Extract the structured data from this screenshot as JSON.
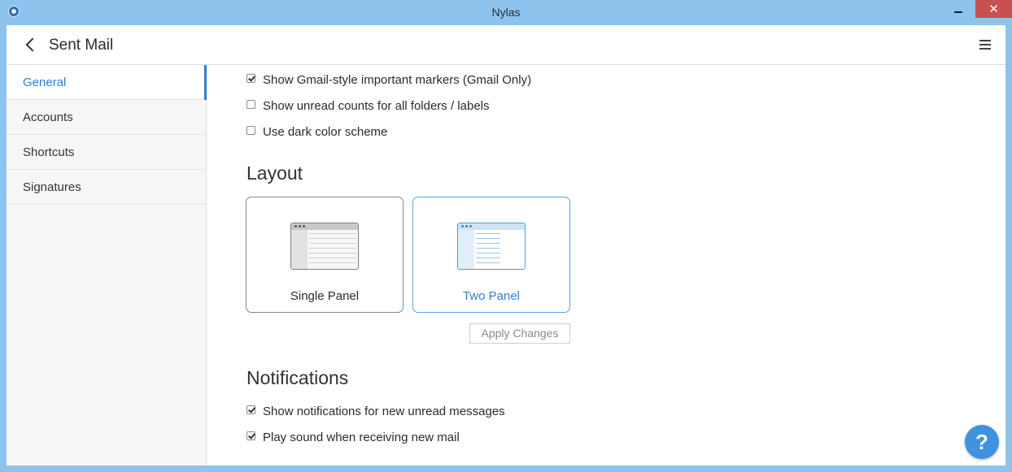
{
  "window": {
    "title": "Nylas",
    "close_glyph": "✕"
  },
  "toolbar": {
    "title": "Sent Mail"
  },
  "sidebar": {
    "items": [
      {
        "label": "General"
      },
      {
        "label": "Accounts"
      },
      {
        "label": "Shortcuts"
      },
      {
        "label": "Signatures"
      }
    ]
  },
  "general": {
    "options": [
      {
        "label": "Show Gmail-style important markers (Gmail Only)",
        "checked": true
      },
      {
        "label": "Show unread counts for all folders / labels",
        "checked": false
      },
      {
        "label": "Use dark color scheme",
        "checked": false
      }
    ]
  },
  "layout": {
    "heading": "Layout",
    "cards": [
      {
        "label": "Single Panel",
        "selected": false
      },
      {
        "label": "Two Panel",
        "selected": true
      }
    ],
    "apply_label": "Apply Changes"
  },
  "notifications": {
    "heading": "Notifications",
    "options": [
      {
        "label": "Show notifications for new unread messages",
        "checked": true
      },
      {
        "label": "Play sound when receiving new mail",
        "checked": true
      }
    ]
  },
  "help": {
    "label": "?"
  },
  "colors": {
    "accent": "#2d7fd3",
    "titlebar": "#8ec3ee",
    "close": "#c75050"
  }
}
